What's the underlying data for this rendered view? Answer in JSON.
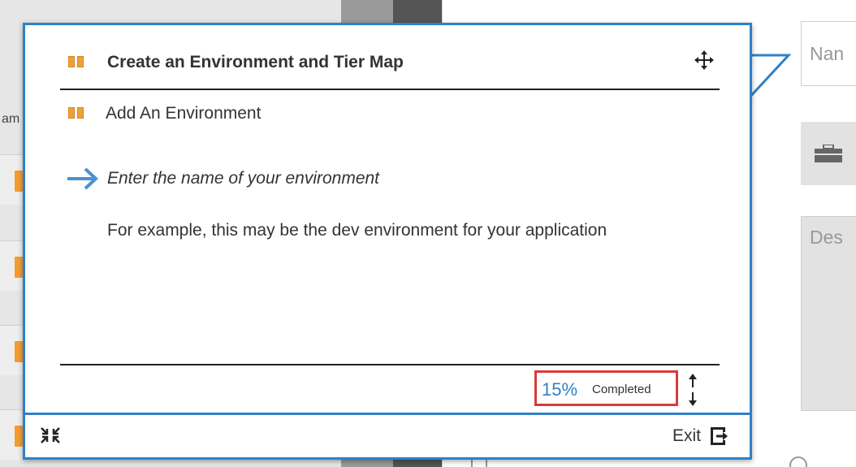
{
  "background": {
    "column_label": "am",
    "name_placeholder": "Nan",
    "description_placeholder": "Des"
  },
  "walkthrough": {
    "title": "Create an Environment and Tier Map",
    "step_title": "Add An Environment",
    "instruction": "Enter the name of your environment",
    "description": "For example, this may be the dev environment for your application",
    "progress_percent": "15%",
    "progress_label": "Completed",
    "exit_label": "Exit"
  },
  "icons": {
    "header": "flow-icon",
    "step": "flow-icon",
    "move": "move-arrows-icon",
    "instruction": "arrow-right-icon",
    "resize": "up-down-arrows-icon",
    "collapse": "collapse-arrows-icon",
    "exit": "exit-icon"
  },
  "colors": {
    "accent": "#2f80c8",
    "highlight": "#d83a3a",
    "flow_icon": "#f0a03a"
  }
}
